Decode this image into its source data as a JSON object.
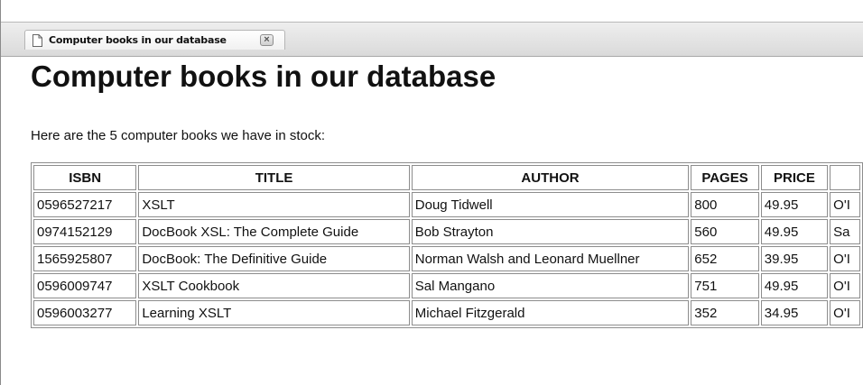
{
  "tab": {
    "title": "Computer books in our database",
    "page_icon": "page-icon",
    "close_icon": "close-icon"
  },
  "page": {
    "heading": "Computer books in our database",
    "intro": "Here are the 5 computer books we have in stock:"
  },
  "table": {
    "headers": [
      "ISBN",
      "TITLE",
      "AUTHOR",
      "PAGES",
      "PRICE",
      ""
    ],
    "rows": [
      [
        "0596527217",
        "XSLT",
        "Doug Tidwell",
        "800",
        "49.95",
        "O'I"
      ],
      [
        "0974152129",
        "DocBook XSL: The Complete Guide",
        "Bob Strayton",
        "560",
        "49.95",
        "Sa"
      ],
      [
        "1565925807",
        "DocBook: The Definitive Guide",
        "Norman Walsh and Leonard Muellner",
        "652",
        "39.95",
        "O'I"
      ],
      [
        "0596009747",
        "XSLT Cookbook",
        "Sal Mangano",
        "751",
        "49.95",
        "O'I"
      ],
      [
        "0596003277",
        "Learning XSLT",
        "Michael Fitzgerald",
        "352",
        "34.95",
        "O'I"
      ]
    ]
  }
}
